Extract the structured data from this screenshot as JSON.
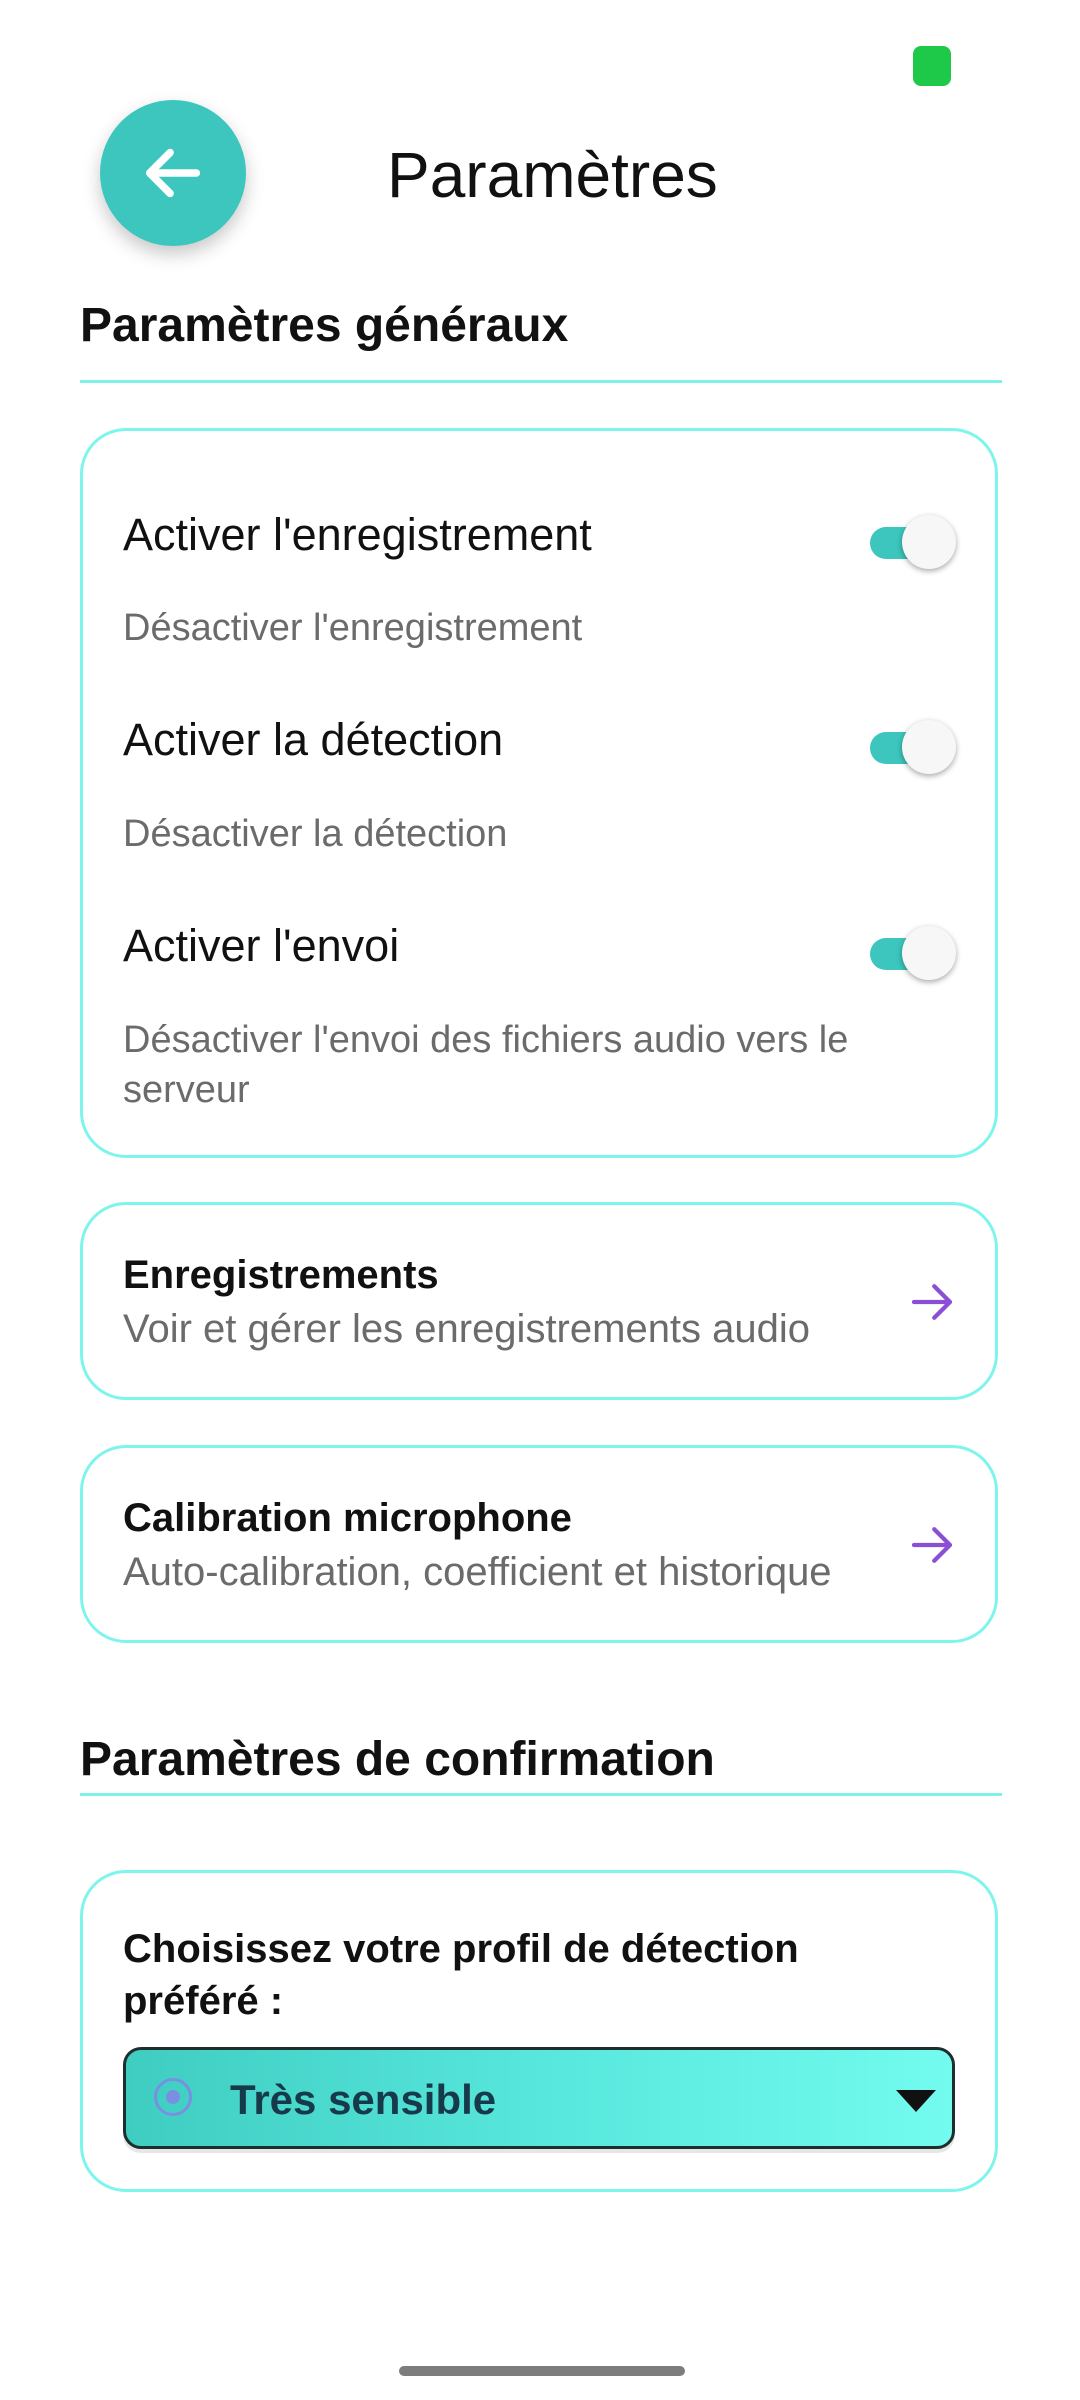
{
  "header": {
    "title": "Paramètres",
    "back_icon": "arrow-left-icon"
  },
  "general": {
    "heading": "Paramètres généraux",
    "settings": [
      {
        "label": "Activer l'enregistrement",
        "description": "Désactiver l'enregistrement",
        "enabled": true
      },
      {
        "label": "Activer la détection",
        "description": "Désactiver la détection",
        "enabled": true
      },
      {
        "label": "Activer l'envoi",
        "description": "Désactiver l'envoi des fichiers audio vers le serveur",
        "enabled": true
      }
    ]
  },
  "nav_cards": [
    {
      "title": "Enregistrements",
      "subtitle": "Voir et gérer les enregistrements audio",
      "icon": "arrow-right-icon"
    },
    {
      "title": "Calibration microphone",
      "subtitle": "Auto-calibration, coefficient et historique",
      "icon": "arrow-right-icon"
    }
  ],
  "confirmation": {
    "heading": "Paramètres de confirmation",
    "prompt": "Choisissez votre profil de détection préféré :",
    "selected_profile": "Très sensible"
  },
  "colors": {
    "accent": "#3cc6bd",
    "card_border": "#7ef5ec",
    "arrow": "#8b4fd6",
    "status_indicator": "#1ec94a"
  }
}
